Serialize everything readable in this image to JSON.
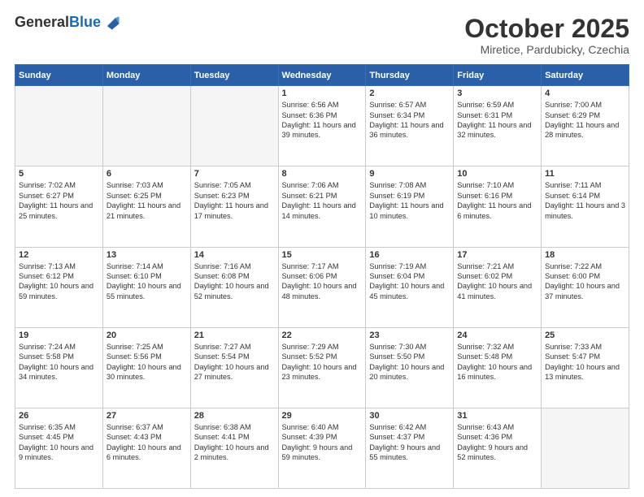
{
  "header": {
    "logo": {
      "general": "General",
      "blue": "Blue"
    },
    "month": "October 2025",
    "location": "Miretice, Pardubicky, Czechia"
  },
  "days_of_week": [
    "Sunday",
    "Monday",
    "Tuesday",
    "Wednesday",
    "Thursday",
    "Friday",
    "Saturday"
  ],
  "weeks": [
    [
      {
        "day": "",
        "empty": true
      },
      {
        "day": "",
        "empty": true
      },
      {
        "day": "",
        "empty": true
      },
      {
        "day": "1",
        "sunrise": "Sunrise: 6:56 AM",
        "sunset": "Sunset: 6:36 PM",
        "daylight": "Daylight: 11 hours and 39 minutes."
      },
      {
        "day": "2",
        "sunrise": "Sunrise: 6:57 AM",
        "sunset": "Sunset: 6:34 PM",
        "daylight": "Daylight: 11 hours and 36 minutes."
      },
      {
        "day": "3",
        "sunrise": "Sunrise: 6:59 AM",
        "sunset": "Sunset: 6:31 PM",
        "daylight": "Daylight: 11 hours and 32 minutes."
      },
      {
        "day": "4",
        "sunrise": "Sunrise: 7:00 AM",
        "sunset": "Sunset: 6:29 PM",
        "daylight": "Daylight: 11 hours and 28 minutes."
      }
    ],
    [
      {
        "day": "5",
        "sunrise": "Sunrise: 7:02 AM",
        "sunset": "Sunset: 6:27 PM",
        "daylight": "Daylight: 11 hours and 25 minutes."
      },
      {
        "day": "6",
        "sunrise": "Sunrise: 7:03 AM",
        "sunset": "Sunset: 6:25 PM",
        "daylight": "Daylight: 11 hours and 21 minutes."
      },
      {
        "day": "7",
        "sunrise": "Sunrise: 7:05 AM",
        "sunset": "Sunset: 6:23 PM",
        "daylight": "Daylight: 11 hours and 17 minutes."
      },
      {
        "day": "8",
        "sunrise": "Sunrise: 7:06 AM",
        "sunset": "Sunset: 6:21 PM",
        "daylight": "Daylight: 11 hours and 14 minutes."
      },
      {
        "day": "9",
        "sunrise": "Sunrise: 7:08 AM",
        "sunset": "Sunset: 6:19 PM",
        "daylight": "Daylight: 11 hours and 10 minutes."
      },
      {
        "day": "10",
        "sunrise": "Sunrise: 7:10 AM",
        "sunset": "Sunset: 6:16 PM",
        "daylight": "Daylight: 11 hours and 6 minutes."
      },
      {
        "day": "11",
        "sunrise": "Sunrise: 7:11 AM",
        "sunset": "Sunset: 6:14 PM",
        "daylight": "Daylight: 11 hours and 3 minutes."
      }
    ],
    [
      {
        "day": "12",
        "sunrise": "Sunrise: 7:13 AM",
        "sunset": "Sunset: 6:12 PM",
        "daylight": "Daylight: 10 hours and 59 minutes."
      },
      {
        "day": "13",
        "sunrise": "Sunrise: 7:14 AM",
        "sunset": "Sunset: 6:10 PM",
        "daylight": "Daylight: 10 hours and 55 minutes."
      },
      {
        "day": "14",
        "sunrise": "Sunrise: 7:16 AM",
        "sunset": "Sunset: 6:08 PM",
        "daylight": "Daylight: 10 hours and 52 minutes."
      },
      {
        "day": "15",
        "sunrise": "Sunrise: 7:17 AM",
        "sunset": "Sunset: 6:06 PM",
        "daylight": "Daylight: 10 hours and 48 minutes."
      },
      {
        "day": "16",
        "sunrise": "Sunrise: 7:19 AM",
        "sunset": "Sunset: 6:04 PM",
        "daylight": "Daylight: 10 hours and 45 minutes."
      },
      {
        "day": "17",
        "sunrise": "Sunrise: 7:21 AM",
        "sunset": "Sunset: 6:02 PM",
        "daylight": "Daylight: 10 hours and 41 minutes."
      },
      {
        "day": "18",
        "sunrise": "Sunrise: 7:22 AM",
        "sunset": "Sunset: 6:00 PM",
        "daylight": "Daylight: 10 hours and 37 minutes."
      }
    ],
    [
      {
        "day": "19",
        "sunrise": "Sunrise: 7:24 AM",
        "sunset": "Sunset: 5:58 PM",
        "daylight": "Daylight: 10 hours and 34 minutes."
      },
      {
        "day": "20",
        "sunrise": "Sunrise: 7:25 AM",
        "sunset": "Sunset: 5:56 PM",
        "daylight": "Daylight: 10 hours and 30 minutes."
      },
      {
        "day": "21",
        "sunrise": "Sunrise: 7:27 AM",
        "sunset": "Sunset: 5:54 PM",
        "daylight": "Daylight: 10 hours and 27 minutes."
      },
      {
        "day": "22",
        "sunrise": "Sunrise: 7:29 AM",
        "sunset": "Sunset: 5:52 PM",
        "daylight": "Daylight: 10 hours and 23 minutes."
      },
      {
        "day": "23",
        "sunrise": "Sunrise: 7:30 AM",
        "sunset": "Sunset: 5:50 PM",
        "daylight": "Daylight: 10 hours and 20 minutes."
      },
      {
        "day": "24",
        "sunrise": "Sunrise: 7:32 AM",
        "sunset": "Sunset: 5:48 PM",
        "daylight": "Daylight: 10 hours and 16 minutes."
      },
      {
        "day": "25",
        "sunrise": "Sunrise: 7:33 AM",
        "sunset": "Sunset: 5:47 PM",
        "daylight": "Daylight: 10 hours and 13 minutes."
      }
    ],
    [
      {
        "day": "26",
        "sunrise": "Sunrise: 6:35 AM",
        "sunset": "Sunset: 4:45 PM",
        "daylight": "Daylight: 10 hours and 9 minutes."
      },
      {
        "day": "27",
        "sunrise": "Sunrise: 6:37 AM",
        "sunset": "Sunset: 4:43 PM",
        "daylight": "Daylight: 10 hours and 6 minutes."
      },
      {
        "day": "28",
        "sunrise": "Sunrise: 6:38 AM",
        "sunset": "Sunset: 4:41 PM",
        "daylight": "Daylight: 10 hours and 2 minutes."
      },
      {
        "day": "29",
        "sunrise": "Sunrise: 6:40 AM",
        "sunset": "Sunset: 4:39 PM",
        "daylight": "Daylight: 9 hours and 59 minutes."
      },
      {
        "day": "30",
        "sunrise": "Sunrise: 6:42 AM",
        "sunset": "Sunset: 4:37 PM",
        "daylight": "Daylight: 9 hours and 55 minutes."
      },
      {
        "day": "31",
        "sunrise": "Sunrise: 6:43 AM",
        "sunset": "Sunset: 4:36 PM",
        "daylight": "Daylight: 9 hours and 52 minutes."
      },
      {
        "day": "",
        "empty": true
      }
    ]
  ]
}
